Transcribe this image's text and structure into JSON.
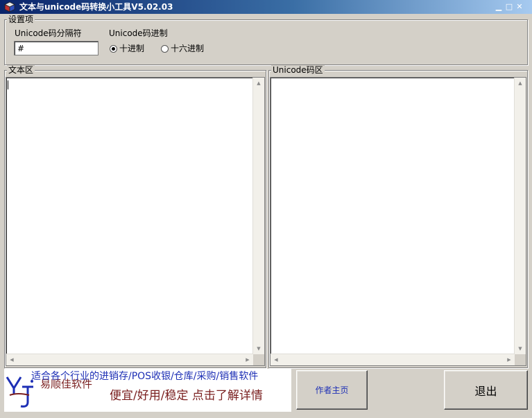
{
  "window": {
    "title": "文本与unicode码转换小工具V5.02.03",
    "icon": "app-cube-icon",
    "controls": {
      "minimize": "▁",
      "maximize": "□",
      "close": "✕"
    }
  },
  "settings": {
    "group_label": "设置项",
    "separator_label": "Unicode码分隔符",
    "separator_value": "#",
    "base_label": "Unicode码进制",
    "radio_decimal": "十进制",
    "radio_hex": "十六进制",
    "selected_base": "decimal"
  },
  "text_panel": {
    "label": "文本区",
    "content": ""
  },
  "unicode_panel": {
    "label": "Unicode码区",
    "content": ""
  },
  "banner": {
    "line1": "适合各个行业的进销存/POS收银/仓库/采购/销售软件",
    "logo_text": "易顺佳软件",
    "line2": "便宜/好用/稳定 点击了解详情"
  },
  "buttons": {
    "author": "作者主页",
    "exit": "退出"
  },
  "colors": {
    "link_blue": "#1d2fb5",
    "banner_red": "#7a1f1f",
    "face": "#d4d0c8"
  }
}
